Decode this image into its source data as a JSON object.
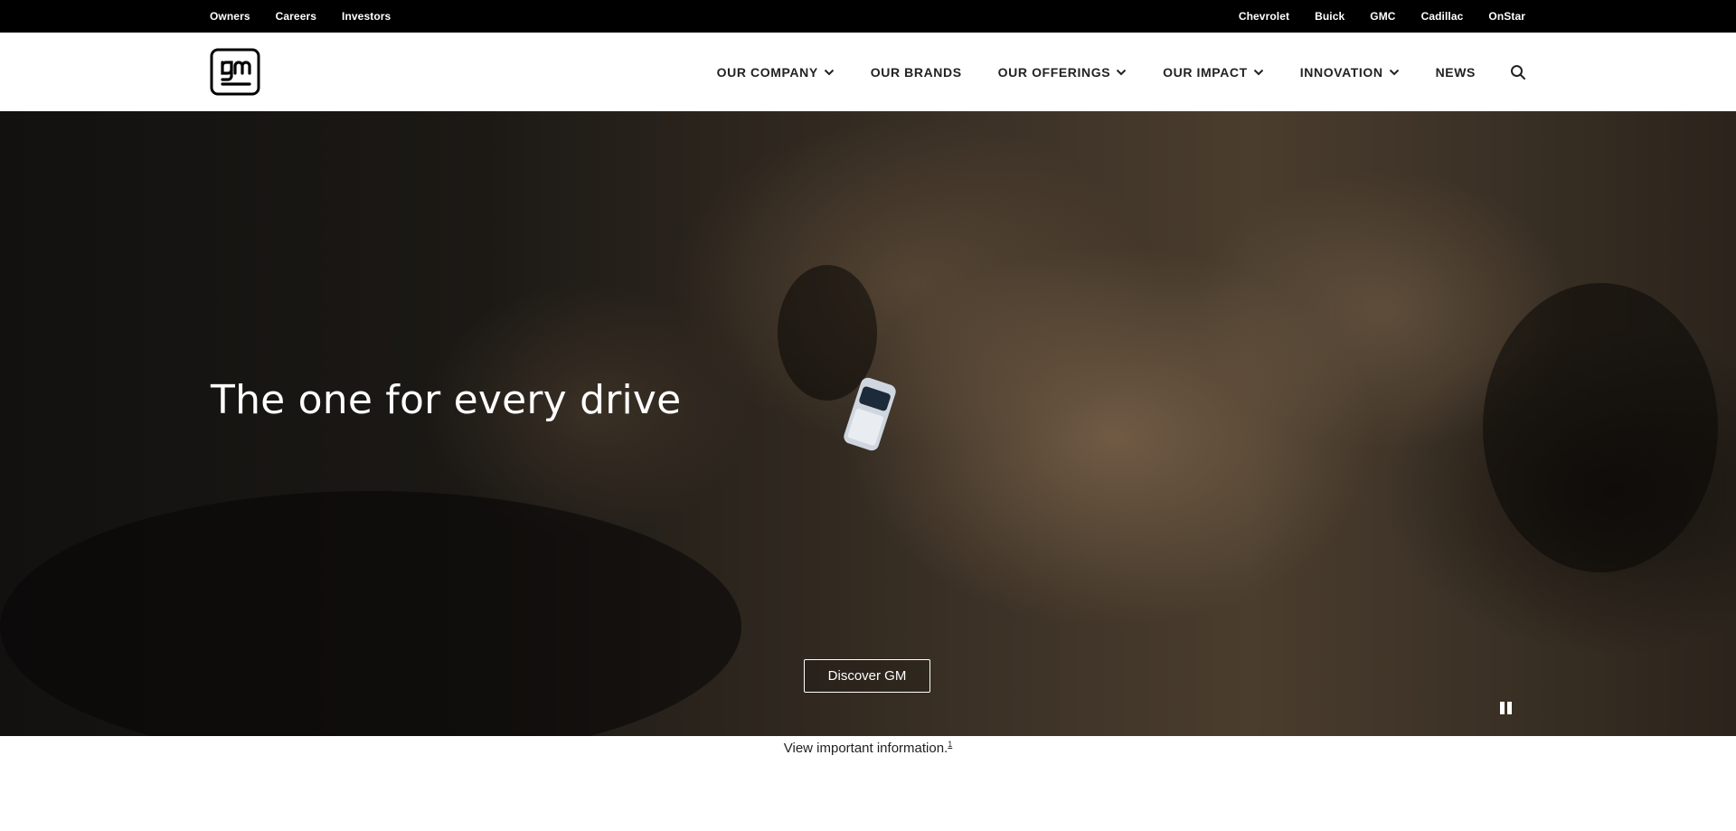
{
  "utility_bar": {
    "left_links": [
      "Owners",
      "Careers",
      "Investors"
    ],
    "right_links": [
      "Chevrolet",
      "Buick",
      "GMC",
      "Cadillac",
      "OnStar"
    ]
  },
  "main_nav": {
    "logo_text": "gm",
    "items": [
      {
        "label": "OUR COMPANY",
        "has_dropdown": true
      },
      {
        "label": "OUR BRANDS",
        "has_dropdown": false
      },
      {
        "label": "OUR OFFERINGS",
        "has_dropdown": true
      },
      {
        "label": "OUR IMPACT",
        "has_dropdown": true
      },
      {
        "label": "INNOVATION",
        "has_dropdown": true
      },
      {
        "label": "NEWS",
        "has_dropdown": false
      }
    ],
    "search_icon": "search-icon"
  },
  "hero": {
    "title": "The one for every drive",
    "cta_label": "Discover GM",
    "pause_icon": "pause-icon"
  },
  "footer_note": {
    "text": "View important information.",
    "footnote": "1"
  },
  "colors": {
    "utility_bg": "#000000",
    "nav_bg": "#ffffff",
    "text_dark": "#222222",
    "hero_text": "#ffffff"
  }
}
